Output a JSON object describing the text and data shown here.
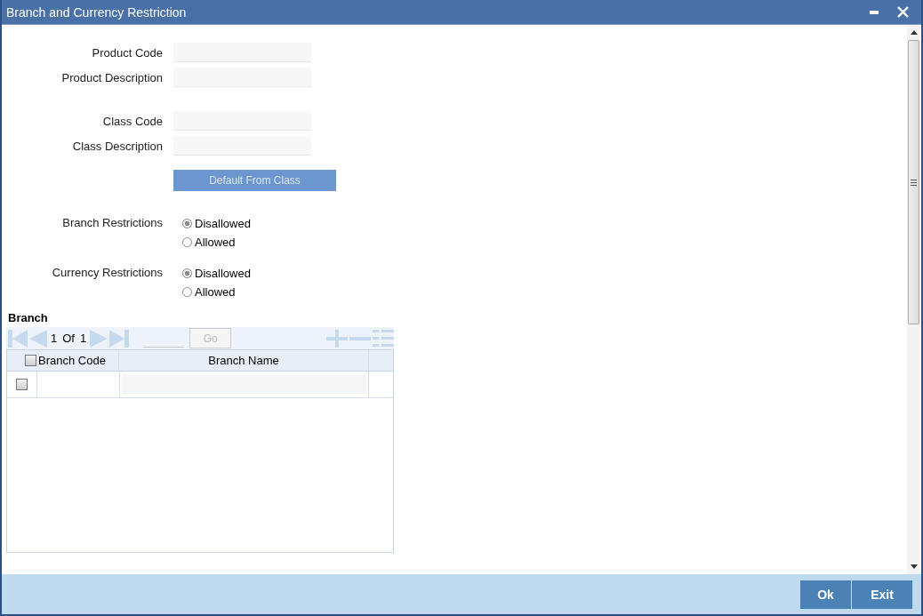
{
  "window": {
    "title": "Branch and Currency Restriction"
  },
  "field_groups": [
    [
      {
        "label": "Product Code"
      },
      {
        "label": "Product Description"
      }
    ],
    [
      {
        "label": "Class Code"
      },
      {
        "label": "Class Description"
      }
    ]
  ],
  "default_button": {
    "label": "Default From Class",
    "disabled": true
  },
  "restrictions": [
    {
      "label": "Branch Restrictions",
      "options": [
        {
          "label": "Disallowed",
          "selected": true
        },
        {
          "label": "Allowed",
          "selected": false
        }
      ]
    },
    {
      "label": "Currency Restrictions",
      "options": [
        {
          "label": "Disallowed",
          "selected": true
        },
        {
          "label": "Allowed",
          "selected": false
        }
      ]
    }
  ],
  "branch": {
    "heading": "Branch",
    "page": "1",
    "of": "Of",
    "pages": "1",
    "go": "Go",
    "columns": [
      {
        "label": "Branch Code",
        "checked": false
      },
      {
        "label": "Branch Name"
      }
    ],
    "rows": [
      {
        "checked": false
      }
    ]
  },
  "buttons": [
    "Ok",
    "Exit"
  ]
}
